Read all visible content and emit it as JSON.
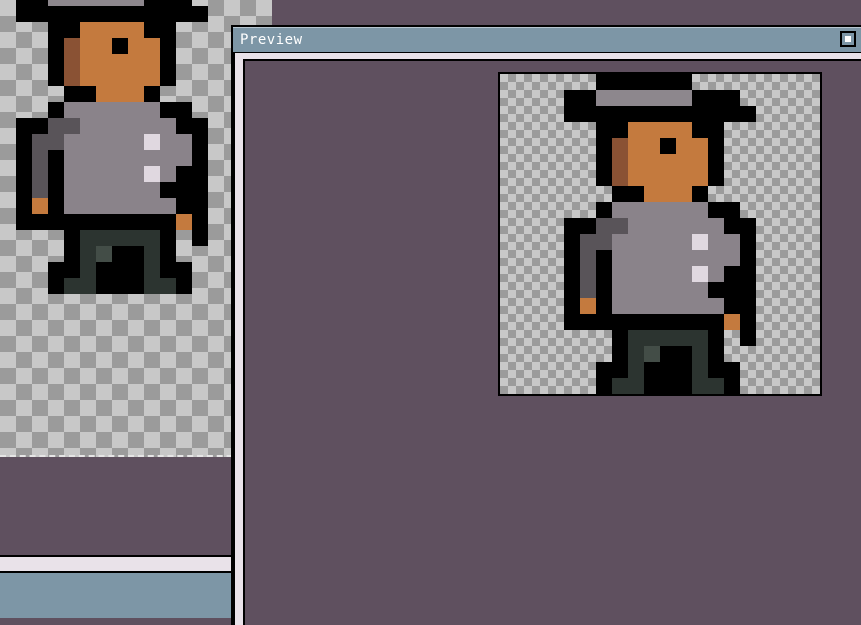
{
  "preview": {
    "title": "Preview",
    "maximize_icon": "maximize-icon"
  },
  "colors": {
    "workspace": "#5f505f",
    "titlebar": "#7d96a6",
    "frame_light": "#e9e2e9",
    "checker_light": "#c8c8c8",
    "checker_dark": "#9b9b9b"
  },
  "sprite": {
    "palette": {
      "k": "#000000",
      "h": "#8d878d",
      "H": "#a09aa0",
      "s": "#c47a3e",
      "S": "#8a5234",
      "g": "#8a838a",
      "G": "#595459",
      "w": "#e0d8e0",
      "p": "#2c3430",
      "P": "#434d47"
    }
  }
}
